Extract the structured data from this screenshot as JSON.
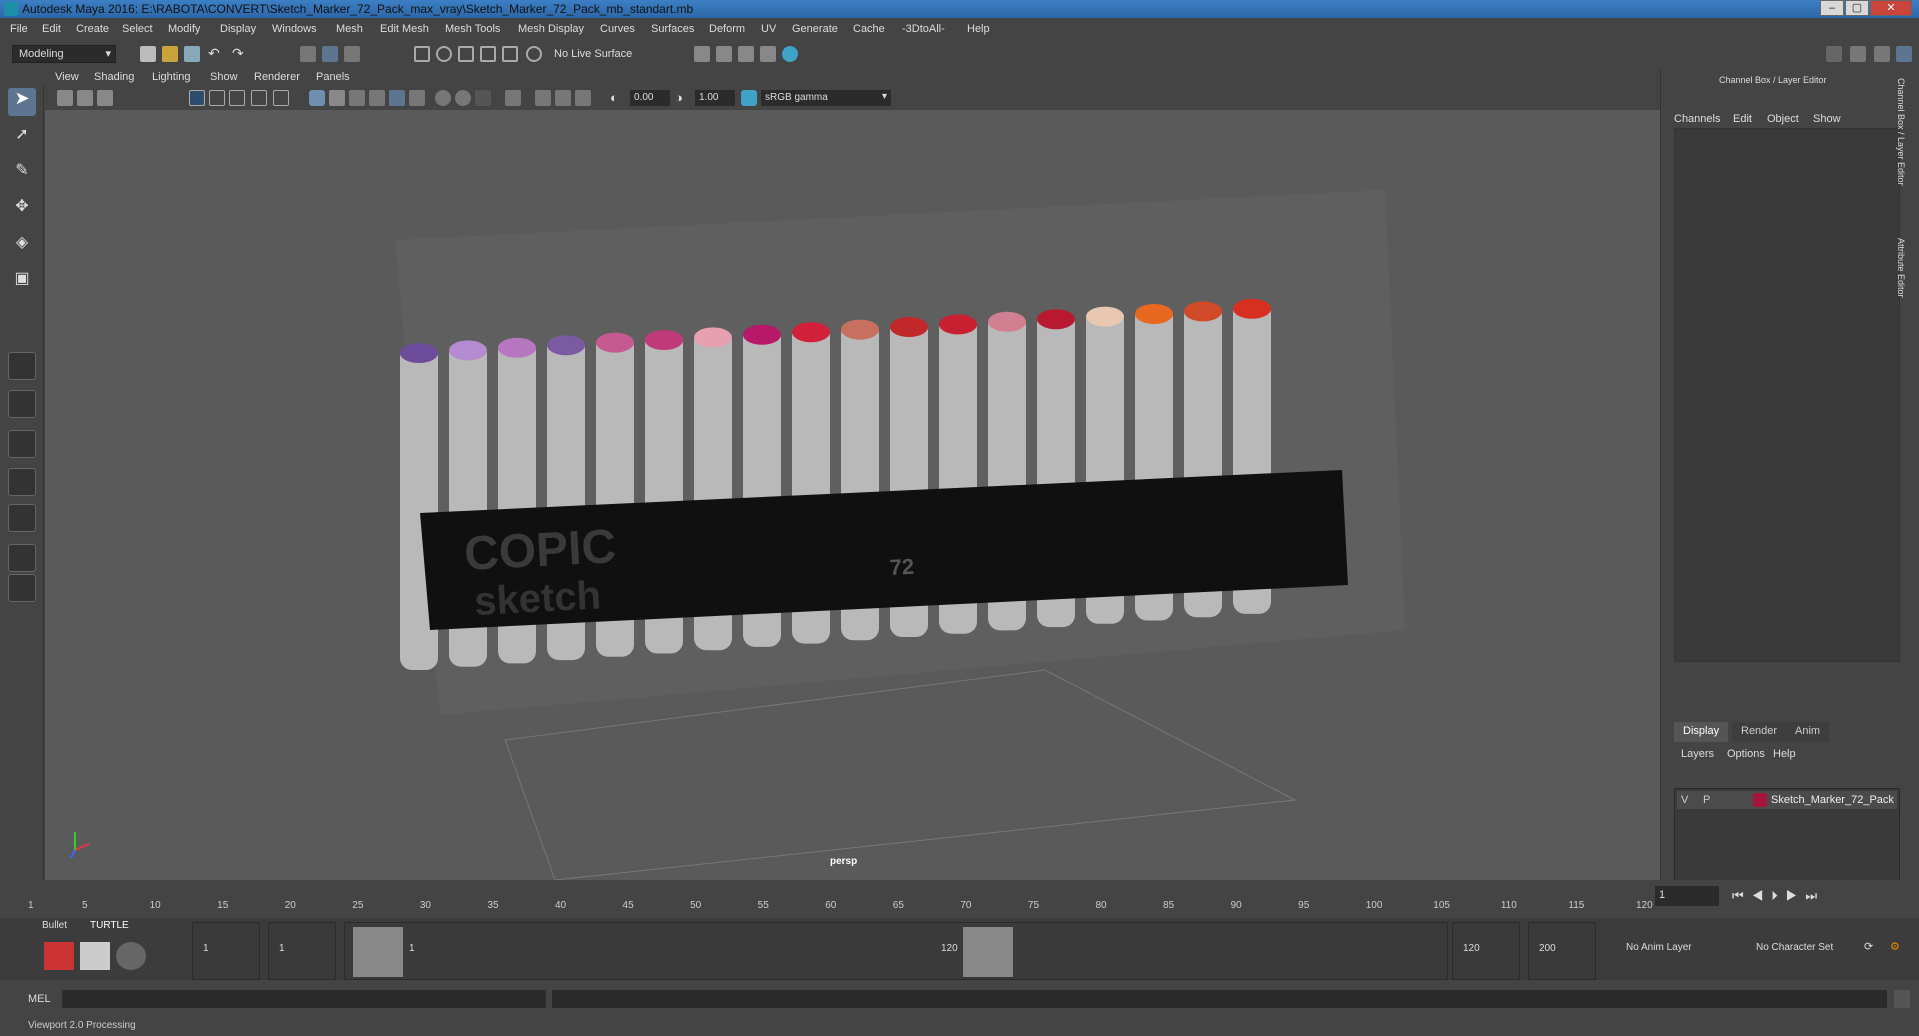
{
  "window": {
    "title": "Autodesk Maya 2016: E:\\RABOTA\\CONVERT\\Sketch_Marker_72_Pack_max_vray\\Sketch_Marker_72_Pack_mb_standart.mb"
  },
  "menubar": [
    "File",
    "Edit",
    "Create",
    "Select",
    "Modify",
    "Display",
    "Windows",
    "Mesh",
    "Edit Mesh",
    "Mesh Tools",
    "Mesh Display",
    "Curves",
    "Surfaces",
    "Deform",
    "UV",
    "Generate",
    "Cache",
    "-3DtoAll-",
    "Help"
  ],
  "shelf": {
    "mode": "Modeling",
    "live_surface": "No Live Surface"
  },
  "viewport": {
    "menus": [
      "View",
      "Shading",
      "Lighting",
      "Show",
      "Renderer",
      "Panels"
    ],
    "field_a": "0.00",
    "field_b": "1.00",
    "color_space": "sRGB gamma",
    "camera_label": "persp",
    "model": {
      "brand": "COPIC",
      "subline": "sketch",
      "count_label": "72"
    }
  },
  "right_panel": {
    "title": "Channel Box / Layer Editor",
    "menu": [
      "Channels",
      "Edit",
      "Object",
      "Show"
    ],
    "tabs": [
      "Display",
      "Render",
      "Anim"
    ],
    "layer_menu": [
      "Layers",
      "Options",
      "Help"
    ],
    "layer": {
      "v": "V",
      "p": "P",
      "name": "Sketch_Marker_72_Pack",
      "color": "#a3173a"
    },
    "side_tabs": [
      "Channel Box / Layer Editor",
      "Attribute Editor"
    ]
  },
  "timeline": {
    "ticks": [
      "1",
      "5",
      "10",
      "15",
      "20",
      "25",
      "30",
      "35",
      "40",
      "45",
      "50",
      "55",
      "60",
      "65",
      "70",
      "75",
      "80",
      "85",
      "90",
      "95",
      "100",
      "105",
      "110",
      "115",
      "120"
    ],
    "current_frame": "1"
  },
  "range": {
    "shelf_tabs": [
      "Bullet",
      "TURTLE"
    ],
    "start": "1",
    "start2": "1",
    "slider_start": "1",
    "slider_end": "120",
    "end": "120",
    "end2": "200",
    "anim_layer": "No Anim Layer",
    "char_set": "No Character Set"
  },
  "cmdline": {
    "label": "MEL"
  },
  "helpline": {
    "text": "Viewport 2.0 Processing"
  }
}
